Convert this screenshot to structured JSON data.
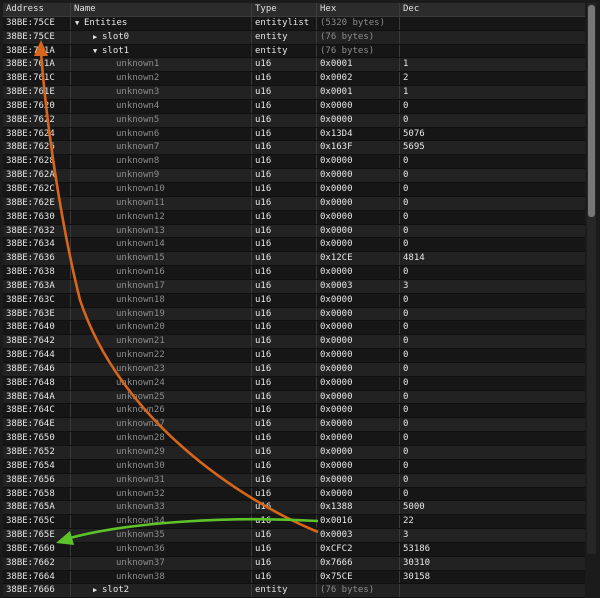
{
  "columns": {
    "address": "Address",
    "name": "Name",
    "type": "Type",
    "hex": "Hex",
    "dec": "Dec"
  },
  "rows": [
    {
      "address": "38BE:75CE",
      "name": "Entities",
      "type": "entitylist",
      "hex": "(5320 bytes)",
      "dec": "",
      "level": 0,
      "toggle": "expanded",
      "dim_hex": true
    },
    {
      "address": "38BE:75CE",
      "name": "slot0",
      "type": "entity",
      "hex": "(76 bytes)",
      "dec": "",
      "level": 1,
      "toggle": "collapsed",
      "dim_hex": true
    },
    {
      "address": "38BE:761A",
      "name": "slot1",
      "type": "entity",
      "hex": "(76 bytes)",
      "dec": "",
      "level": 1,
      "toggle": "expanded",
      "dim_hex": true
    },
    {
      "address": "38BE:761A",
      "name": "unknown1",
      "type": "u16",
      "hex": "0x0001",
      "dec": "1",
      "level": 2
    },
    {
      "address": "38BE:761C",
      "name": "unknown2",
      "type": "u16",
      "hex": "0x0002",
      "dec": "2",
      "level": 2
    },
    {
      "address": "38BE:761E",
      "name": "unknown3",
      "type": "u16",
      "hex": "0x0001",
      "dec": "1",
      "level": 2
    },
    {
      "address": "38BE:7620",
      "name": "unknown4",
      "type": "u16",
      "hex": "0x0000",
      "dec": "0",
      "level": 2
    },
    {
      "address": "38BE:7622",
      "name": "unknown5",
      "type": "u16",
      "hex": "0x0000",
      "dec": "0",
      "level": 2
    },
    {
      "address": "38BE:7624",
      "name": "unknown6",
      "type": "u16",
      "hex": "0x13D4",
      "dec": "5076",
      "level": 2
    },
    {
      "address": "38BE:7626",
      "name": "unknown7",
      "type": "u16",
      "hex": "0x163F",
      "dec": "5695",
      "level": 2
    },
    {
      "address": "38BE:7628",
      "name": "unknown8",
      "type": "u16",
      "hex": "0x0000",
      "dec": "0",
      "level": 2
    },
    {
      "address": "38BE:762A",
      "name": "unknown9",
      "type": "u16",
      "hex": "0x0000",
      "dec": "0",
      "level": 2
    },
    {
      "address": "38BE:762C",
      "name": "unknown10",
      "type": "u16",
      "hex": "0x0000",
      "dec": "0",
      "level": 2
    },
    {
      "address": "38BE:762E",
      "name": "unknown11",
      "type": "u16",
      "hex": "0x0000",
      "dec": "0",
      "level": 2
    },
    {
      "address": "38BE:7630",
      "name": "unknown12",
      "type": "u16",
      "hex": "0x0000",
      "dec": "0",
      "level": 2
    },
    {
      "address": "38BE:7632",
      "name": "unknown13",
      "type": "u16",
      "hex": "0x0000",
      "dec": "0",
      "level": 2
    },
    {
      "address": "38BE:7634",
      "name": "unknown14",
      "type": "u16",
      "hex": "0x0000",
      "dec": "0",
      "level": 2
    },
    {
      "address": "38BE:7636",
      "name": "unknown15",
      "type": "u16",
      "hex": "0x12CE",
      "dec": "4814",
      "level": 2
    },
    {
      "address": "38BE:7638",
      "name": "unknown16",
      "type": "u16",
      "hex": "0x0000",
      "dec": "0",
      "level": 2
    },
    {
      "address": "38BE:763A",
      "name": "unknown17",
      "type": "u16",
      "hex": "0x0003",
      "dec": "3",
      "level": 2
    },
    {
      "address": "38BE:763C",
      "name": "unknown18",
      "type": "u16",
      "hex": "0x0000",
      "dec": "0",
      "level": 2
    },
    {
      "address": "38BE:763E",
      "name": "unknown19",
      "type": "u16",
      "hex": "0x0000",
      "dec": "0",
      "level": 2
    },
    {
      "address": "38BE:7640",
      "name": "unknown20",
      "type": "u16",
      "hex": "0x0000",
      "dec": "0",
      "level": 2
    },
    {
      "address": "38BE:7642",
      "name": "unknown21",
      "type": "u16",
      "hex": "0x0000",
      "dec": "0",
      "level": 2
    },
    {
      "address": "38BE:7644",
      "name": "unknown22",
      "type": "u16",
      "hex": "0x0000",
      "dec": "0",
      "level": 2
    },
    {
      "address": "38BE:7646",
      "name": "unknown23",
      "type": "u16",
      "hex": "0x0000",
      "dec": "0",
      "level": 2
    },
    {
      "address": "38BE:7648",
      "name": "unknown24",
      "type": "u16",
      "hex": "0x0000",
      "dec": "0",
      "level": 2
    },
    {
      "address": "38BE:764A",
      "name": "unknown25",
      "type": "u16",
      "hex": "0x0000",
      "dec": "0",
      "level": 2
    },
    {
      "address": "38BE:764C",
      "name": "unknown26",
      "type": "u16",
      "hex": "0x0000",
      "dec": "0",
      "level": 2
    },
    {
      "address": "38BE:764E",
      "name": "unknown27",
      "type": "u16",
      "hex": "0x0000",
      "dec": "0",
      "level": 2
    },
    {
      "address": "38BE:7650",
      "name": "unknown28",
      "type": "u16",
      "hex": "0x0000",
      "dec": "0",
      "level": 2
    },
    {
      "address": "38BE:7652",
      "name": "unknown29",
      "type": "u16",
      "hex": "0x0000",
      "dec": "0",
      "level": 2
    },
    {
      "address": "38BE:7654",
      "name": "unknown30",
      "type": "u16",
      "hex": "0x0000",
      "dec": "0",
      "level": 2
    },
    {
      "address": "38BE:7656",
      "name": "unknown31",
      "type": "u16",
      "hex": "0x0000",
      "dec": "0",
      "level": 2
    },
    {
      "address": "38BE:7658",
      "name": "unknown32",
      "type": "u16",
      "hex": "0x0000",
      "dec": "0",
      "level": 2
    },
    {
      "address": "38BE:765A",
      "name": "unknown33",
      "type": "u16",
      "hex": "0x1388",
      "dec": "5000",
      "level": 2
    },
    {
      "address": "38BE:765C",
      "name": "unknown34",
      "type": "u16",
      "hex": "0x0016",
      "dec": "22",
      "level": 2
    },
    {
      "address": "38BE:765E",
      "name": "unknown35",
      "type": "u16",
      "hex": "0x0003",
      "dec": "3",
      "level": 2
    },
    {
      "address": "38BE:7660",
      "name": "unknown36",
      "type": "u16",
      "hex": "0xCFC2",
      "dec": "53186",
      "level": 2
    },
    {
      "address": "38BE:7662",
      "name": "unknown37",
      "type": "u16",
      "hex": "0x7666",
      "dec": "30310",
      "level": 2
    },
    {
      "address": "38BE:7664",
      "name": "unknown38",
      "type": "u16",
      "hex": "0x75CE",
      "dec": "30158",
      "level": 2
    },
    {
      "address": "38BE:7666",
      "name": "slot2",
      "type": "entity",
      "hex": "(76 bytes)",
      "dec": "",
      "level": 1,
      "toggle": "collapsed",
      "dim_hex": true
    }
  ],
  "annotations": {
    "orange_color": "#d8661a",
    "green_color": "#5ec32a"
  },
  "icons": {
    "expanded": "triangle-down-icon",
    "collapsed": "triangle-right-icon"
  }
}
